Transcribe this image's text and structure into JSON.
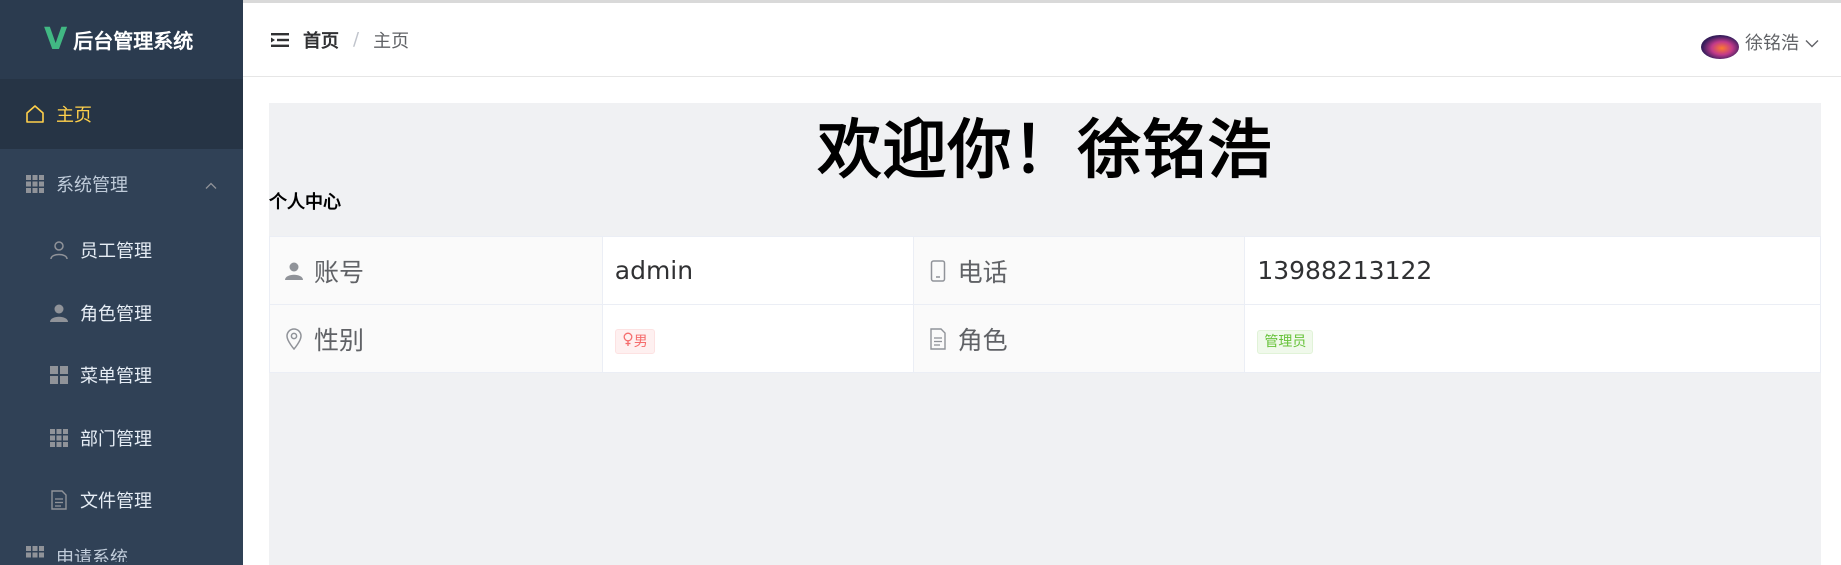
{
  "app": {
    "logo_letter": "V",
    "title": "后台管理系统"
  },
  "sidebar": {
    "items": [
      {
        "label": "主页",
        "icon": "home-icon"
      },
      {
        "label": "系统管理",
        "icon": "grid-icon"
      },
      {
        "label": "员工管理",
        "icon": "user-outline-icon"
      },
      {
        "label": "角色管理",
        "icon": "user-solid-icon"
      },
      {
        "label": "菜单管理",
        "icon": "menu-grid-icon"
      },
      {
        "label": "部门管理",
        "icon": "grid-icon"
      },
      {
        "label": "文件管理",
        "icon": "document-icon"
      },
      {
        "label": "申请系统",
        "icon": "grid-icon"
      }
    ]
  },
  "header": {
    "breadcrumb_home": "首页",
    "breadcrumb_sep": "/",
    "breadcrumb_current": "主页",
    "user_name": "徐铭浩"
  },
  "main": {
    "welcome": "欢迎你！徐铭浩",
    "section_title": "个人中心",
    "profile": {
      "account_label": "账号",
      "account_value": "admin",
      "phone_label": "电话",
      "phone_value": "13988213122",
      "gender_label": "性别",
      "gender_value": "男",
      "role_label": "角色",
      "role_value": "管理员"
    }
  },
  "colors": {
    "sidebar_bg": "#304156",
    "active_text": "#ffd04b",
    "logo_accent": "#41b883",
    "tag_red": "#f56c6c",
    "tag_green": "#67c23a"
  }
}
